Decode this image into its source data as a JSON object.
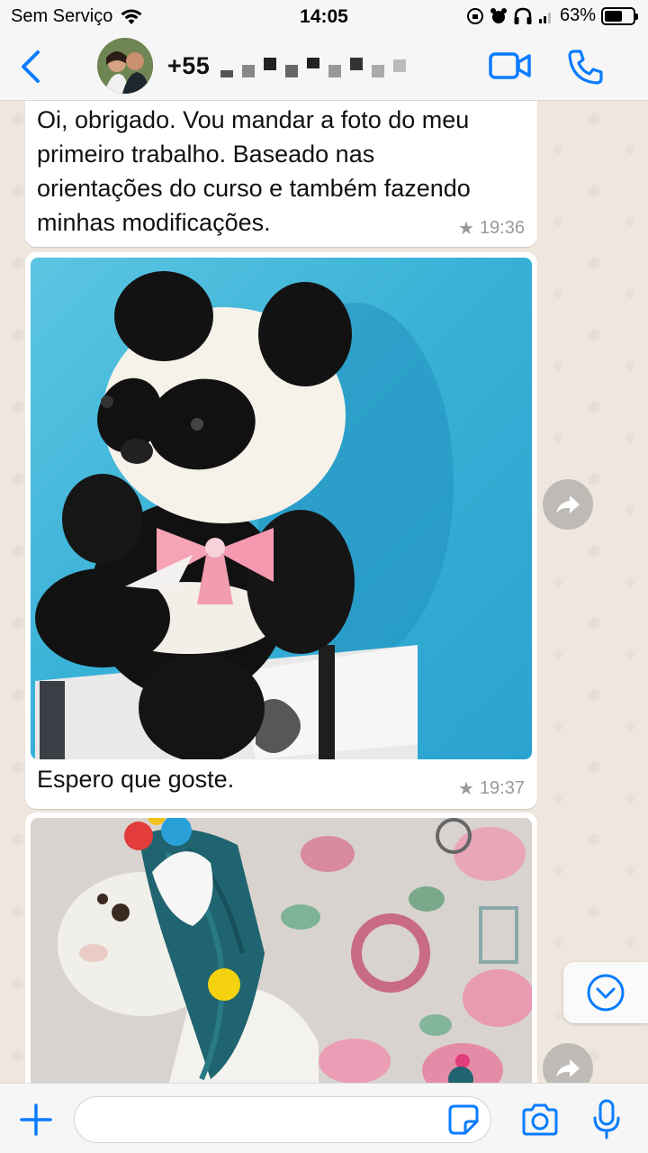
{
  "status_bar": {
    "carrier": "Sem Serviço",
    "time": "14:05",
    "battery": "63%",
    "battery_level": 0.63
  },
  "header": {
    "contact": "+55",
    "back_icon": "chevron-left-icon",
    "video_icon": "video-camera-icon",
    "call_icon": "phone-icon"
  },
  "messages": [
    {
      "type": "text",
      "text_lines": [
        "Oi, obrigado. Vou mandar a foto do meu",
        "primeiro trabalho. Baseado nas",
        "orientações do curso e também fazendo",
        "minhas modificações."
      ],
      "time": "19:36",
      "starred": true
    },
    {
      "type": "image",
      "image_subject": "crochet-panda-photo",
      "caption": "Espero que goste.",
      "time": "19:37",
      "starred": true
    },
    {
      "type": "image",
      "image_subject": "crochet-unicorn-photo"
    }
  ],
  "input": {
    "value": "",
    "placeholder": ""
  },
  "colors": {
    "accent": "#0a7cff",
    "chat_background": "#efe7dd",
    "bubble": "#ffffff",
    "wall_blue": "#3bb3d6"
  }
}
